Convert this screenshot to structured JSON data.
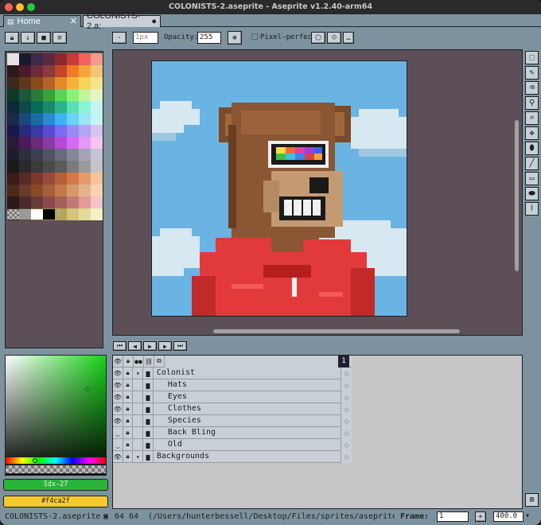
{
  "window": {
    "title": "COLONISTS-2.aseprite - Aseprite v1.2.40-arm64"
  },
  "tabs": [
    {
      "label": "Home"
    },
    {
      "label": "COLONISTS-2.a:"
    }
  ],
  "toolbar": {
    "brush_size": "1px",
    "opacity_label": "Opacity:",
    "opacity_value": "255",
    "pixel_perfect_label": "Pixel-perfect"
  },
  "palette": {
    "colors": [
      "#e4e4e4",
      "#1a1a2a",
      "#3c2a4a",
      "#5a2a3c",
      "#8a2a2e",
      "#c63c36",
      "#f4605a",
      "#f49a8a",
      "#2a1a1a",
      "#4a1a2a",
      "#6a2a3a",
      "#8a3a3a",
      "#c2462a",
      "#f07a2a",
      "#f4a63a",
      "#f4c47a",
      "#3a2a1a",
      "#5a3a1a",
      "#8a4a1a",
      "#b4622a",
      "#e28a2a",
      "#f4b43a",
      "#f4d45a",
      "#f4e48a",
      "#0a3a2a",
      "#1a5a3a",
      "#2a7a3a",
      "#3aa03a",
      "#5ad25a",
      "#8af27a",
      "#c4f4a0",
      "#e4f4c4",
      "#0a2a3a",
      "#0a4a4a",
      "#0a6a5a",
      "#1a8a6a",
      "#2ab48a",
      "#5ae0b4",
      "#8af4d4",
      "#c4f4f0",
      "#1a2a4a",
      "#1a4a7a",
      "#1a6aa4",
      "#2a8ad2",
      "#3ab4f4",
      "#6ad2f4",
      "#9ae4f4",
      "#c4f4f4",
      "#1a1a4a",
      "#2a2a7a",
      "#3a3aa4",
      "#5a4ad2",
      "#7a6af4",
      "#9a8af4",
      "#b4a4f4",
      "#d4c4f4",
      "#2a1a3a",
      "#4a1a5a",
      "#6a2a7a",
      "#8a3aa4",
      "#b44ad2",
      "#d46af4",
      "#e49af4",
      "#f4c4f4",
      "#1e1e2a",
      "#2e2e3e",
      "#3e3e52",
      "#525266",
      "#6a6a7e",
      "#86869a",
      "#a4a4b6",
      "#c4c4d4",
      "#1a1a1a",
      "#2a2a2a",
      "#3a3a3a",
      "#4a4a4a",
      "#5a5a5a",
      "#7a7a7a",
      "#9a9a9a",
      "#c4c4c4",
      "#3a1a1a",
      "#5a2a2a",
      "#7a3a2a",
      "#9a4a3a",
      "#b4603a",
      "#d27a4a",
      "#e49a6a",
      "#f4c49a",
      "#4a2a1a",
      "#6a3a2a",
      "#8a4a2a",
      "#a4603a",
      "#c27a4a",
      "#d49a6a",
      "#e4b48a",
      "#f4d4b4",
      "#2a1a1a",
      "#4a2a2a",
      "#6a3a3a",
      "#8a4a4a",
      "#a4605a",
      "#c27a7a",
      "#e49a9a",
      "#f4c4c4",
      "#3a2a1a",
      "#5a4a2a",
      "#7a6a3a",
      "#9a8a4a",
      "#b4a45a",
      "#d2c47a",
      "#e4da9a",
      "#f4f0c4"
    ]
  },
  "color_bars": {
    "foreground_label": "Idx-27",
    "foreground_color": "#2ab33a",
    "background_label": "#f4ca2f",
    "background_color": "#f4ca2f"
  },
  "timeline": {
    "frame_number": "1",
    "layers": [
      {
        "name": "Colonist",
        "indent": 0,
        "visible": true
      },
      {
        "name": "Hats",
        "indent": 1,
        "visible": true
      },
      {
        "name": "Eyes",
        "indent": 1,
        "visible": true
      },
      {
        "name": "Clothes",
        "indent": 1,
        "visible": true
      },
      {
        "name": "Species",
        "indent": 1,
        "visible": true
      },
      {
        "name": "Back Bling",
        "indent": 1,
        "visible": false
      },
      {
        "name": "Old",
        "indent": 1,
        "visible": false
      },
      {
        "name": "Backgrounds",
        "indent": 0,
        "visible": true
      }
    ]
  },
  "status": {
    "filename": "COLONISTS-2.aseprite",
    "dims": "64 64",
    "path": "(/Users/hunterbessell/Desktop/Files/sprites/aseprite projects",
    "frame_label": "Frame:",
    "frame_value": "1",
    "zoom": "400.0"
  }
}
